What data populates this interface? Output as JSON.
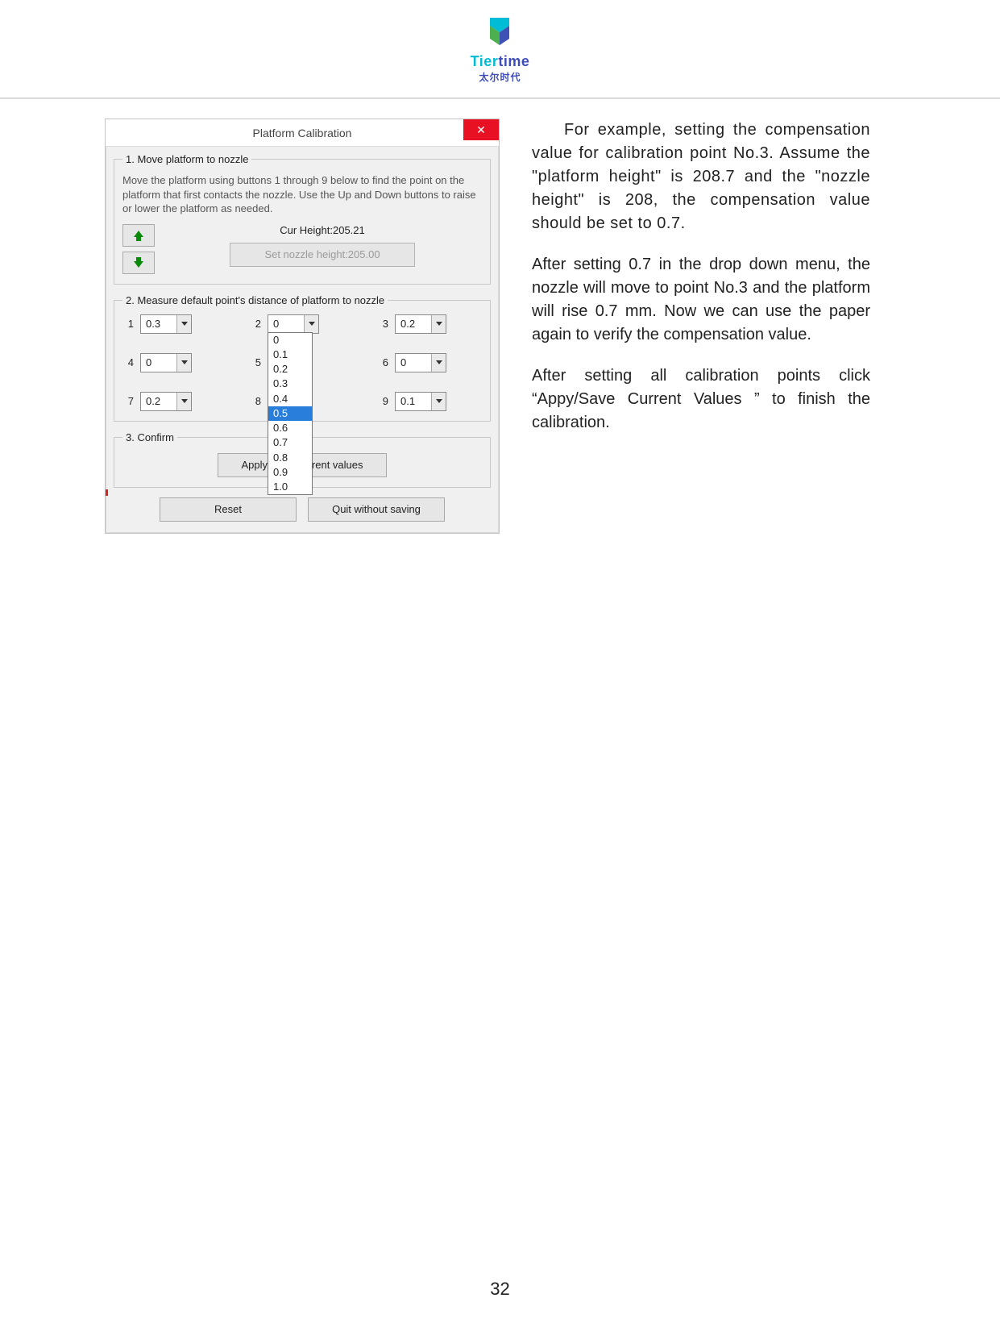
{
  "brand": {
    "name_part1": "Tier",
    "name_part2": "time",
    "subtitle": "太尔时代"
  },
  "dialog": {
    "title": "Platform Calibration",
    "section1": {
      "legend": "1. Move platform to nozzle",
      "instructions": "Move the platform using buttons 1 through 9 below to find the point on the platform that first contacts the nozzle. Use the Up and Down buttons to raise or lower the platform as needed.",
      "cur_height": "Cur Height:205.21",
      "set_nozzle_label": "Set nozzle height:205.00"
    },
    "section2": {
      "legend": "2. Measure default point's distance of platform to nozzle",
      "cells": [
        {
          "n": "1",
          "v": "0.3"
        },
        {
          "n": "2",
          "v": "0"
        },
        {
          "n": "3",
          "v": "0.2"
        },
        {
          "n": "4",
          "v": "0"
        },
        {
          "n": "5",
          "v": ""
        },
        {
          "n": "6",
          "v": "0"
        },
        {
          "n": "7",
          "v": "0.2"
        },
        {
          "n": "8",
          "v": ""
        },
        {
          "n": "9",
          "v": "0.1"
        }
      ],
      "dropdown_options": [
        "0",
        "0.1",
        "0.2",
        "0.3",
        "0.4",
        "0.5",
        "0.6",
        "0.7",
        "0.8",
        "0.9",
        "1.0"
      ],
      "dropdown_selected": "0.5"
    },
    "section3": {
      "legend": "3. Confirm",
      "apply_label": "Apply/Save current values"
    },
    "reset_label": "Reset",
    "quit_label": "Quit without saving"
  },
  "explain": {
    "p1": "For example, setting the compensation value for calibration point No.3. Assume the \"platform height\" is 208.7 and the \"nozzle height\" is 208, the compensation value should be set to 0.7.",
    "p2": "After setting 0.7 in the drop down menu, the nozzle will move to point No.3 and the platform will rise 0.7 mm. Now we can use the paper again to verify the compensation value.",
    "p3": "After setting all calibration points click “Appy/Save Current Values ” to finish the calibration."
  },
  "page_number": "32"
}
